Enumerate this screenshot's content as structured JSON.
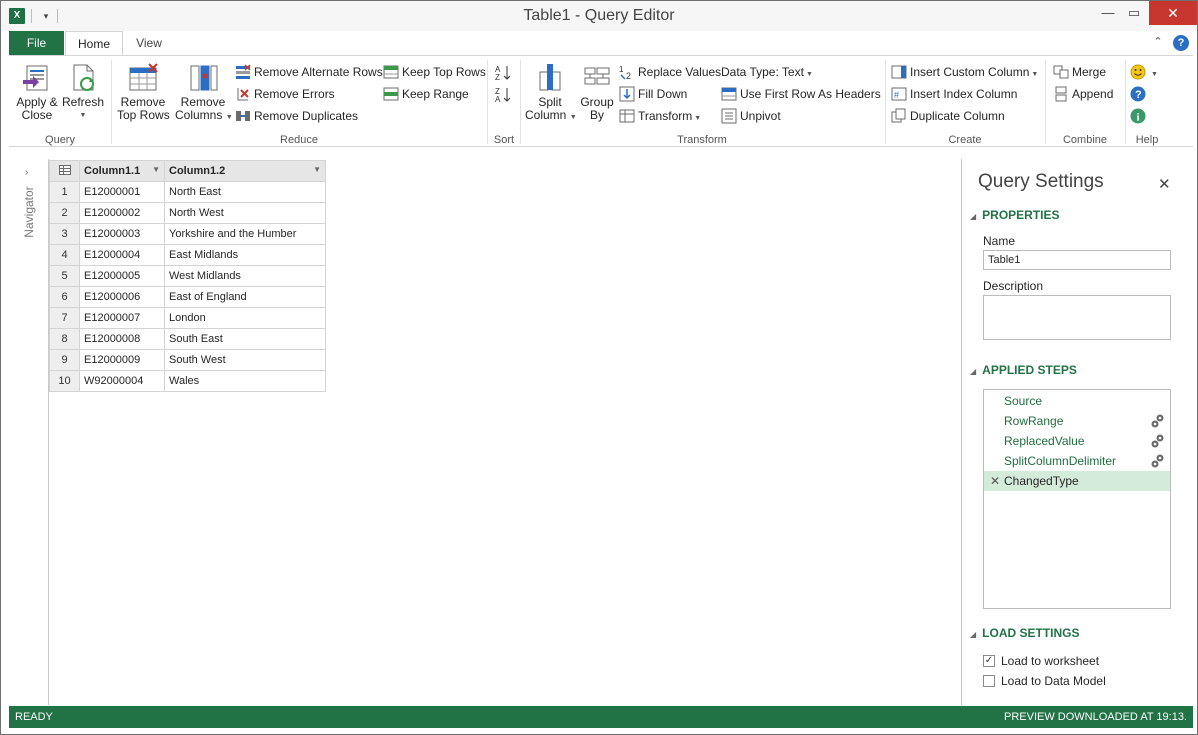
{
  "window": {
    "title": "Table1 - Query Editor",
    "app_icon_glyph": "X"
  },
  "tabs": {
    "file": "File",
    "home": "Home",
    "view": "View"
  },
  "ribbon": {
    "query": {
      "label": "Query",
      "apply_close": [
        "Apply &",
        "Close"
      ],
      "refresh": "Refresh"
    },
    "reduce": {
      "label": "Reduce",
      "remove_top_rows": [
        "Remove",
        "Top Rows"
      ],
      "remove_columns": [
        "Remove",
        "Columns"
      ],
      "remove_alternate_rows": "Remove Alternate Rows",
      "remove_errors": "Remove Errors",
      "remove_duplicates": "Remove Duplicates",
      "keep_top_rows": "Keep Top Rows",
      "keep_range": "Keep Range"
    },
    "sort": {
      "label": "Sort"
    },
    "transform": {
      "label": "Transform",
      "split_column": [
        "Split",
        "Column"
      ],
      "group_by": [
        "Group",
        "By"
      ],
      "replace_values": "Replace Values",
      "fill_down": "Fill Down",
      "transform": "Transform",
      "data_type": "Data Type: Text",
      "use_first_row": "Use First Row As Headers",
      "unpivot": "Unpivot"
    },
    "create": {
      "label": "Create",
      "insert_custom_column": "Insert Custom Column",
      "insert_index_column": "Insert Index Column",
      "duplicate_column": "Duplicate Column"
    },
    "combine": {
      "label": "Combine",
      "merge": "Merge",
      "append": "Append"
    },
    "help": {
      "label": "Help"
    }
  },
  "navigator": {
    "label": "Navigator"
  },
  "grid": {
    "columns": [
      "Column1.1",
      "Column1.2"
    ],
    "rows": [
      [
        "1",
        "E12000001",
        "North East"
      ],
      [
        "2",
        "E12000002",
        "North West"
      ],
      [
        "3",
        "E12000003",
        "Yorkshire and the Humber"
      ],
      [
        "4",
        "E12000004",
        "East Midlands"
      ],
      [
        "5",
        "E12000005",
        "West Midlands"
      ],
      [
        "6",
        "E12000006",
        "East of England"
      ],
      [
        "7",
        "E12000007",
        "London"
      ],
      [
        "8",
        "E12000008",
        "South East"
      ],
      [
        "9",
        "E12000009",
        "South West"
      ],
      [
        "10",
        "W92000004",
        "Wales"
      ]
    ]
  },
  "query_settings": {
    "title": "Query Settings",
    "properties_label": "PROPERTIES",
    "name_label": "Name",
    "name_value": "Table1",
    "description_label": "Description",
    "applied_steps_label": "APPLIED STEPS",
    "steps": [
      {
        "name": "Source",
        "gear": false,
        "selected": false
      },
      {
        "name": "RowRange",
        "gear": true,
        "selected": false
      },
      {
        "name": "ReplacedValue",
        "gear": true,
        "selected": false
      },
      {
        "name": "SplitColumnDelimiter",
        "gear": true,
        "selected": false
      },
      {
        "name": "ChangedType",
        "gear": false,
        "selected": true
      }
    ],
    "load_settings_label": "LOAD SETTINGS",
    "load_to_worksheet": "Load to worksheet",
    "load_to_worksheet_checked": true,
    "load_to_data_model": "Load to Data Model",
    "load_to_data_model_checked": false
  },
  "status": {
    "left": "READY",
    "right": "PREVIEW DOWNLOADED AT 19:13."
  },
  "colors": {
    "accent_green": "#217346",
    "close_red": "#c7372f"
  }
}
